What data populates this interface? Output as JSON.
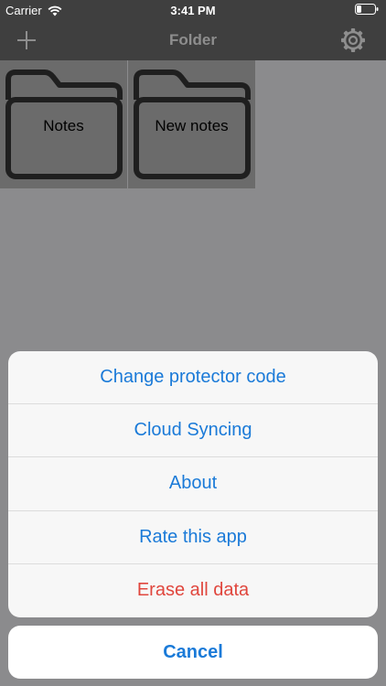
{
  "status_bar": {
    "carrier": "Carrier",
    "time": "3:41 PM",
    "icons": [
      "wifi-icon",
      "battery-icon"
    ]
  },
  "nav_bar": {
    "title": "Folder",
    "left_icon": "plus-icon",
    "right_icon": "gear-icon"
  },
  "folders": [
    {
      "name": "Notes"
    },
    {
      "name": "New notes"
    }
  ],
  "action_sheet": {
    "items": [
      {
        "label": "Change protector code"
      },
      {
        "label": "Cloud Syncing"
      },
      {
        "label": "About"
      },
      {
        "label": "Rate this app"
      },
      {
        "label": "Erase all data",
        "destructive": true
      }
    ],
    "cancel_label": "Cancel"
  },
  "colors": {
    "bar_background": "#3f3f3f",
    "dim_overlay": "#8b8b8d",
    "action_blue": "#1a7ad8",
    "destructive_red": "#e0463d"
  }
}
